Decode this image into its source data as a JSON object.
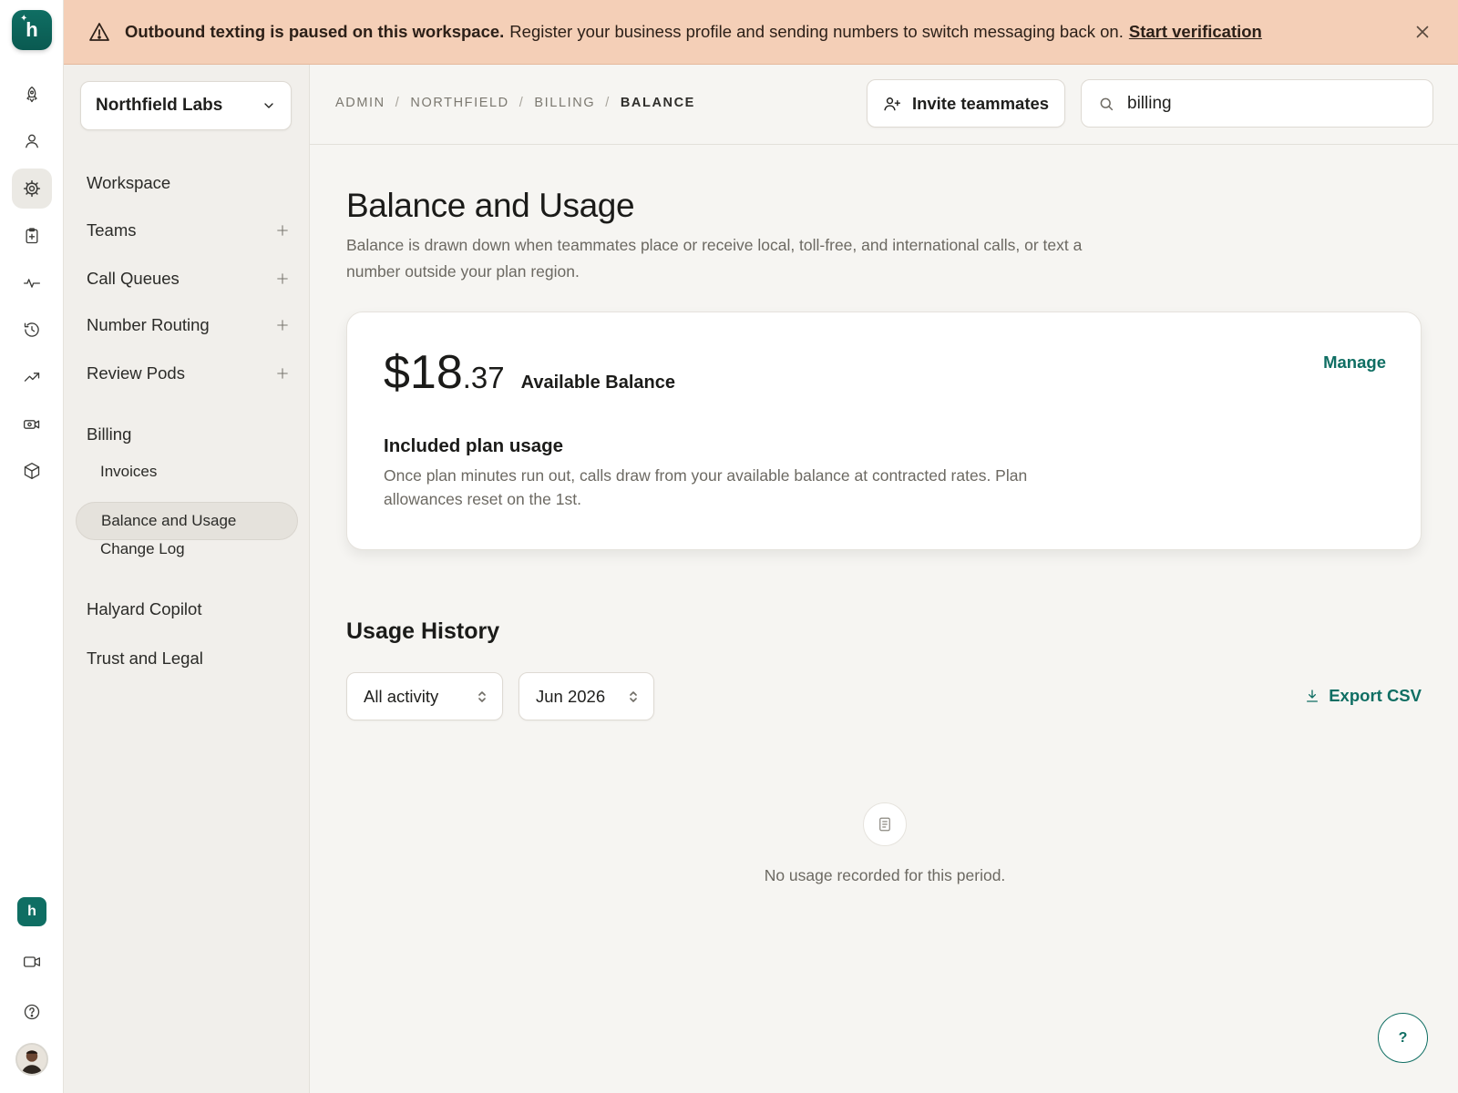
{
  "rail": {
    "logo_letter": "h",
    "workspace_badge": "h",
    "icons": [
      "rocket-icon",
      "user-icon",
      "settings-icon",
      "clipboard-icon",
      "activity-icon",
      "history-icon",
      "trending-icon",
      "video-card-icon",
      "package-icon"
    ],
    "bottom_icons": [
      "video-icon",
      "help-icon"
    ]
  },
  "banner": {
    "bold": "Outbound texting is paused on this workspace.",
    "message": "Register your business profile and sending numbers to switch messaging back on.",
    "link": "Start verification",
    "bg_color": "#f4cfb7"
  },
  "sidebar": {
    "workspace_name": "Northfield Labs",
    "items": [
      {
        "label": "Workspace"
      },
      {
        "label": "Teams"
      },
      {
        "label": "Call Queues"
      },
      {
        "label": "Number Routing"
      },
      {
        "label": "Review Pods"
      },
      {
        "label": "Billing"
      },
      {
        "label": "Halyard Copilot"
      },
      {
        "label": "Trust and Legal"
      }
    ],
    "billing_sub": [
      {
        "label": "Invoices"
      },
      {
        "label": "Balance and Usage"
      },
      {
        "label": "Change Log"
      }
    ]
  },
  "header": {
    "breadcrumbs": [
      "ADMIN",
      "NORTHFIELD",
      "BILLING",
      "BALANCE"
    ],
    "separator": "/",
    "invite_label": "Invite teammates",
    "search_value": "billing"
  },
  "main": {
    "title": "Balance and Usage",
    "description": "Balance is drawn down when teammates place or receive local, toll-free, and international calls, or text a number outside your plan region.",
    "balance": {
      "currency": "$",
      "whole": "18",
      "cents": ".37",
      "label": "Available Balance",
      "manage_label": "Manage"
    },
    "included": {
      "title": "Included plan usage",
      "description": "Once plan minutes run out, calls draw from your available balance at contracted rates. Plan allowances reset on the 1st."
    },
    "history": {
      "title": "Usage History",
      "activity_filter": "All activity",
      "period_filter": "Jun 2026",
      "export_label": "Export CSV",
      "empty_text": "No usage recorded for this period."
    }
  },
  "help_fab": "?",
  "colors": {
    "accent": "#0f6e63",
    "banner": "#f4cfb7"
  }
}
